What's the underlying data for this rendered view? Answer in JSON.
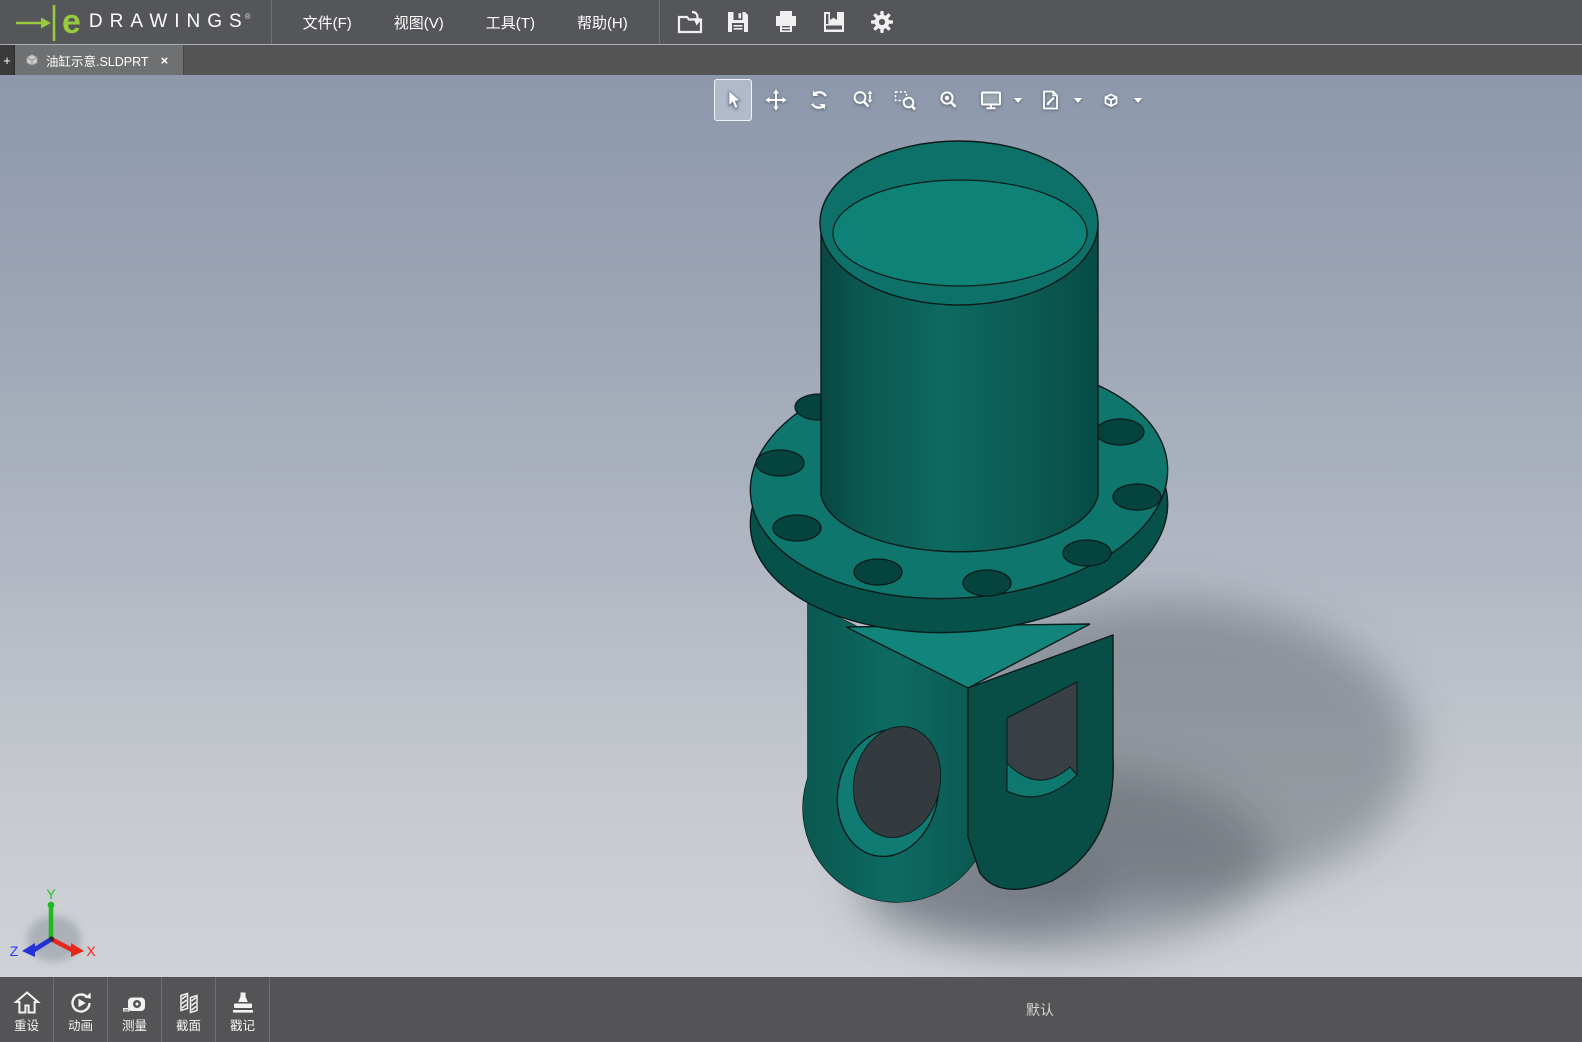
{
  "app_title": "eDrawings",
  "brand": {
    "arrow_icon": "green-arrow",
    "logo_letter": "e",
    "logo_text": "DRAWINGS",
    "reg_mark": "®",
    "accent_green": "#97ca3d"
  },
  "menubar": {
    "items": [
      "文件(F)",
      "视图(V)",
      "工具(T)",
      "帮助(H)"
    ]
  },
  "quick_toolbar": {
    "buttons": [
      {
        "icon": "open-file"
      },
      {
        "icon": "save"
      },
      {
        "icon": "print"
      },
      {
        "icon": "publish-box"
      },
      {
        "icon": "settings-gear"
      }
    ]
  },
  "tab_bar": {
    "new_tab_label": "+",
    "tabs": [
      {
        "icon": "part-cube",
        "title": "油缸示意.SLDPRT",
        "close_label": "×",
        "active": true
      }
    ]
  },
  "view_toolbar": {
    "buttons": [
      {
        "icon": "select-cursor",
        "active": true
      },
      {
        "icon": "pan-arrows"
      },
      {
        "icon": "rotate-arrows"
      },
      {
        "icon": "zoom-in-out"
      },
      {
        "icon": "zoom-area"
      },
      {
        "icon": "zoom-fit"
      },
      {
        "icon": "display-monitor",
        "dropdown": true
      },
      {
        "icon": "markup-page",
        "dropdown": true
      },
      {
        "icon": "views-cube",
        "dropdown": true
      }
    ]
  },
  "viewport": {
    "background_top": "#8d98ac",
    "background_bottom": "#cfd3d8",
    "model": {
      "name": "油缸示意",
      "body_color": "#0d6a62",
      "top_face_color": "#0f8278",
      "outline_color": "#0b1b19"
    }
  },
  "axes_triad": {
    "x_label": "X",
    "y_label": "Y",
    "z_label": "Z",
    "x_color": "#e8271c",
    "y_color": "#1dba20",
    "z_color": "#2430d8"
  },
  "bottom_bar": {
    "buttons": [
      {
        "icon": "home",
        "label": "重设"
      },
      {
        "icon": "animation",
        "label": "动画"
      },
      {
        "icon": "measure-tape",
        "label": "测量"
      },
      {
        "icon": "section-cut",
        "label": "截面"
      },
      {
        "icon": "stamp",
        "label": "戳记"
      }
    ],
    "configuration_label": "默认"
  }
}
